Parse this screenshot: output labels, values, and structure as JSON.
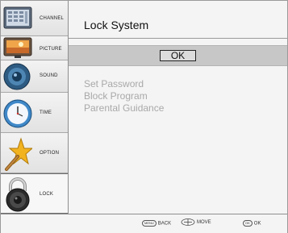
{
  "sidebar": {
    "items": [
      {
        "label": "CHANNEL",
        "icon": "channel-icon"
      },
      {
        "label": "PICTURE",
        "icon": "picture-icon"
      },
      {
        "label": "SOUND",
        "icon": "sound-icon"
      },
      {
        "label": "TIME",
        "icon": "time-icon"
      },
      {
        "label": "OPTION",
        "icon": "option-icon"
      },
      {
        "label": "LOCK",
        "icon": "lock-icon",
        "selected": true
      }
    ]
  },
  "main": {
    "title": "Lock System",
    "ok_label": "OK",
    "menu": [
      "Set Password",
      "Block Program",
      "Parental Guidance"
    ]
  },
  "footer": {
    "menu_key": "MENU",
    "back_label": "BACK",
    "move_label": "MOVE",
    "ok_key": "OK",
    "ok_label": "OK"
  },
  "colors": {
    "disabled_text": "#a9a9a9",
    "highlight_band": "#c7c7c7"
  }
}
